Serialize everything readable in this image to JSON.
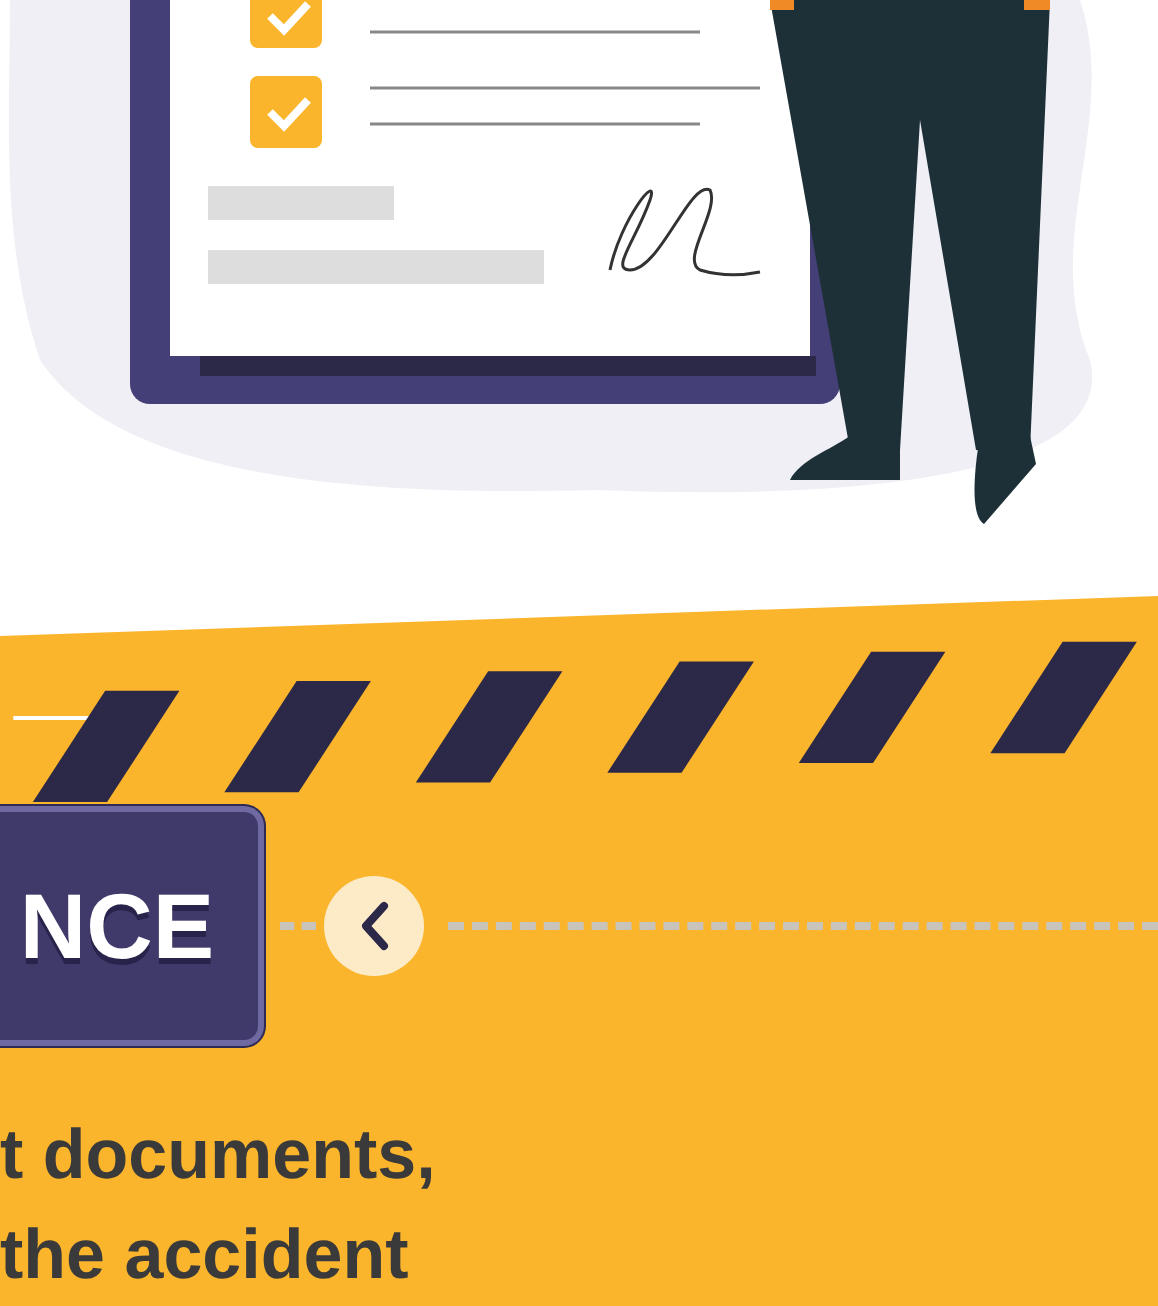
{
  "badge": {
    "text": "NCE"
  },
  "paragraph": {
    "text": "t documents,\nthe accident"
  }
}
